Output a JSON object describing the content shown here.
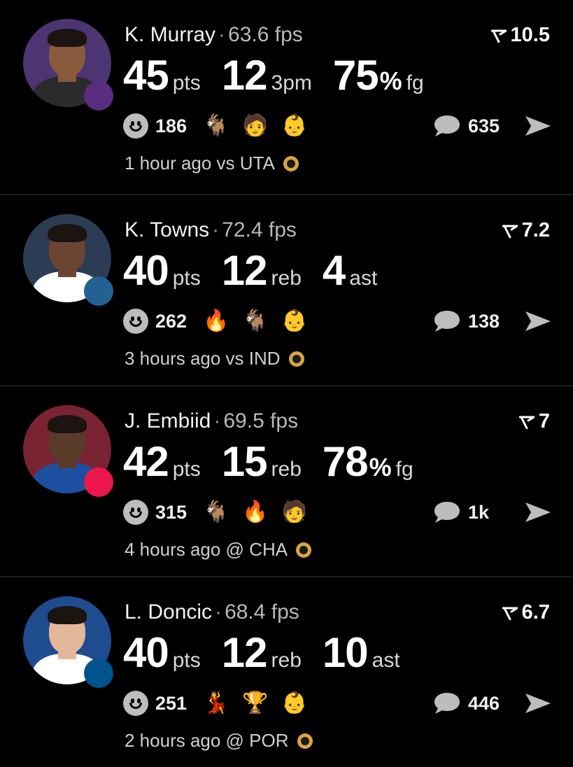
{
  "colors": {
    "background": "#000000",
    "divider": "#1c1c1e",
    "text_primary": "#ffffff",
    "text_secondary": "#b8b8b8"
  },
  "posts": [
    {
      "player": "K. Murray",
      "fps": "63.6 fps",
      "rating": "10.5",
      "stats": [
        {
          "value": "45",
          "unit": "pts"
        },
        {
          "value": "12",
          "unit": "3pm"
        },
        {
          "value": "75",
          "percent": "%",
          "unit": "fg"
        }
      ],
      "reaction_count": "186",
      "reaction_emojis": [
        "goat-icon",
        "player-face-icon",
        "baby-face-icon"
      ],
      "comment_count": "635",
      "time": "1 hour ago vs UTA",
      "team_logo": "kings-logo-icon",
      "opponent_logo": "jazz-logo-icon",
      "team_color": "#5a2d81",
      "avatar_bg": "#4c3572"
    },
    {
      "player": "K. Towns",
      "fps": "72.4 fps",
      "rating": "7.2",
      "stats": [
        {
          "value": "40",
          "unit": "pts"
        },
        {
          "value": "12",
          "unit": "reb"
        },
        {
          "value": "4",
          "unit": "ast"
        }
      ],
      "reaction_count": "262",
      "reaction_emojis": [
        "cooking-icon",
        "goat-icon",
        "baby-face-icon"
      ],
      "comment_count": "138",
      "time": "3 hours ago vs IND",
      "team_logo": "timberwolves-logo-icon",
      "opponent_logo": "pacers-logo-icon",
      "team_color": "#236192",
      "avatar_bg": "#2c3c55"
    },
    {
      "player": "J. Embiid",
      "fps": "69.5 fps",
      "rating": "7",
      "stats": [
        {
          "value": "42",
          "unit": "pts"
        },
        {
          "value": "15",
          "unit": "reb"
        },
        {
          "value": "78",
          "percent": "%",
          "unit": "fg"
        }
      ],
      "reaction_count": "315",
      "reaction_emojis": [
        "goat-icon",
        "fire-icon",
        "player-face-icon"
      ],
      "comment_count": "1k",
      "time": "4 hours ago @ CHA",
      "team_logo": "sixers-logo-icon",
      "opponent_logo": "hornets-logo-icon",
      "team_color": "#ed174c",
      "avatar_bg": "#7a2433"
    },
    {
      "player": "L. Doncic",
      "fps": "68.4 fps",
      "rating": "6.7",
      "stats": [
        {
          "value": "40",
          "unit": "pts"
        },
        {
          "value": "12",
          "unit": "reb"
        },
        {
          "value": "10",
          "unit": "ast"
        }
      ],
      "reaction_count": "251",
      "reaction_emojis": [
        "celebrity-icon",
        "trophy-icon",
        "baby-face-icon"
      ],
      "comment_count": "446",
      "time": "2 hours ago @ POR",
      "team_logo": "mavericks-logo-icon",
      "opponent_logo": "blazers-logo-icon",
      "team_color": "#00538c",
      "avatar_bg": "#1f4c8f"
    }
  ]
}
